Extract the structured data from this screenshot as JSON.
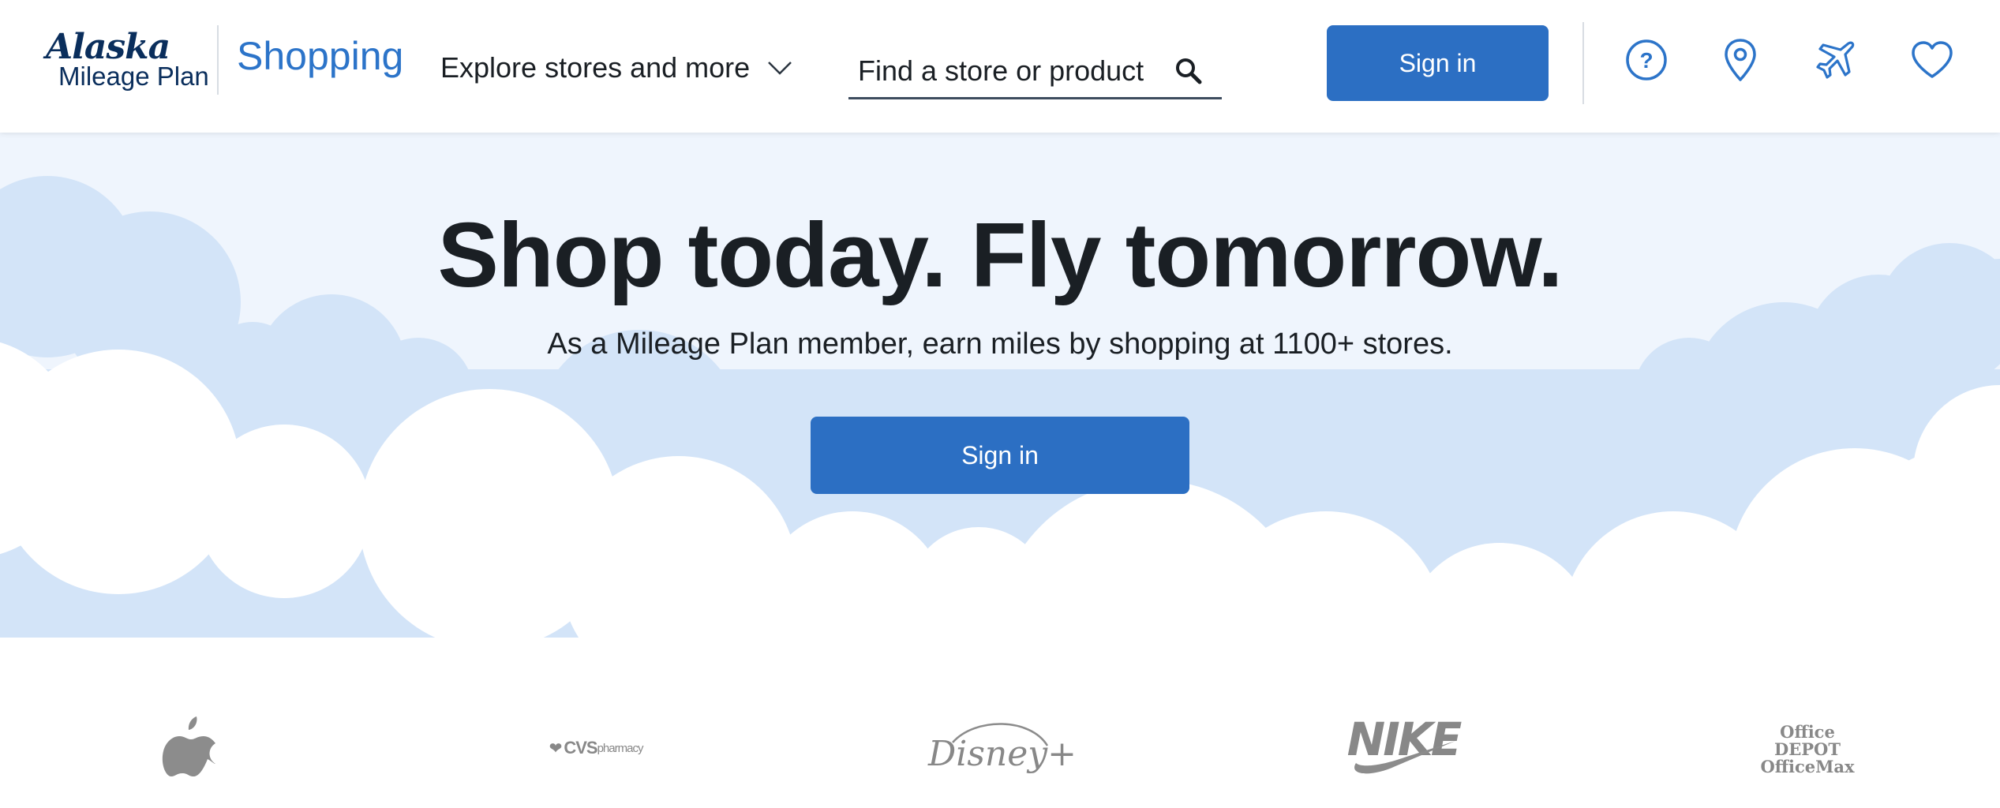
{
  "header": {
    "logo": {
      "brand": "Alaska",
      "sub": "Mileage Plan"
    },
    "shopping_label": "Shopping",
    "explore_label": "Explore stores and more",
    "search": {
      "placeholder": "Find a store or product"
    },
    "signin_label": "Sign in",
    "icons": [
      "help-icon",
      "location-pin-icon",
      "airplane-icon",
      "heart-icon"
    ]
  },
  "hero": {
    "title": "Shop today. Fly tomorrow.",
    "subtitle": "As a Mileage Plan member, earn miles by shopping at 1100+ stores.",
    "signin_label": "Sign in"
  },
  "brands": {
    "cvs": {
      "name": "CVS",
      "suffix": "pharmacy"
    },
    "disney": "Disney+",
    "nike": "NIKE",
    "office_depot": "Office DEPOT",
    "office_max": "OfficeMax"
  },
  "colors": {
    "accent": "#2c6fc3",
    "link": "#2c74c9",
    "hero_bg": "#eff5fd",
    "cloud_light": "#d3e4f8",
    "text": "#1a1f24",
    "logo_gray": "#888888"
  }
}
